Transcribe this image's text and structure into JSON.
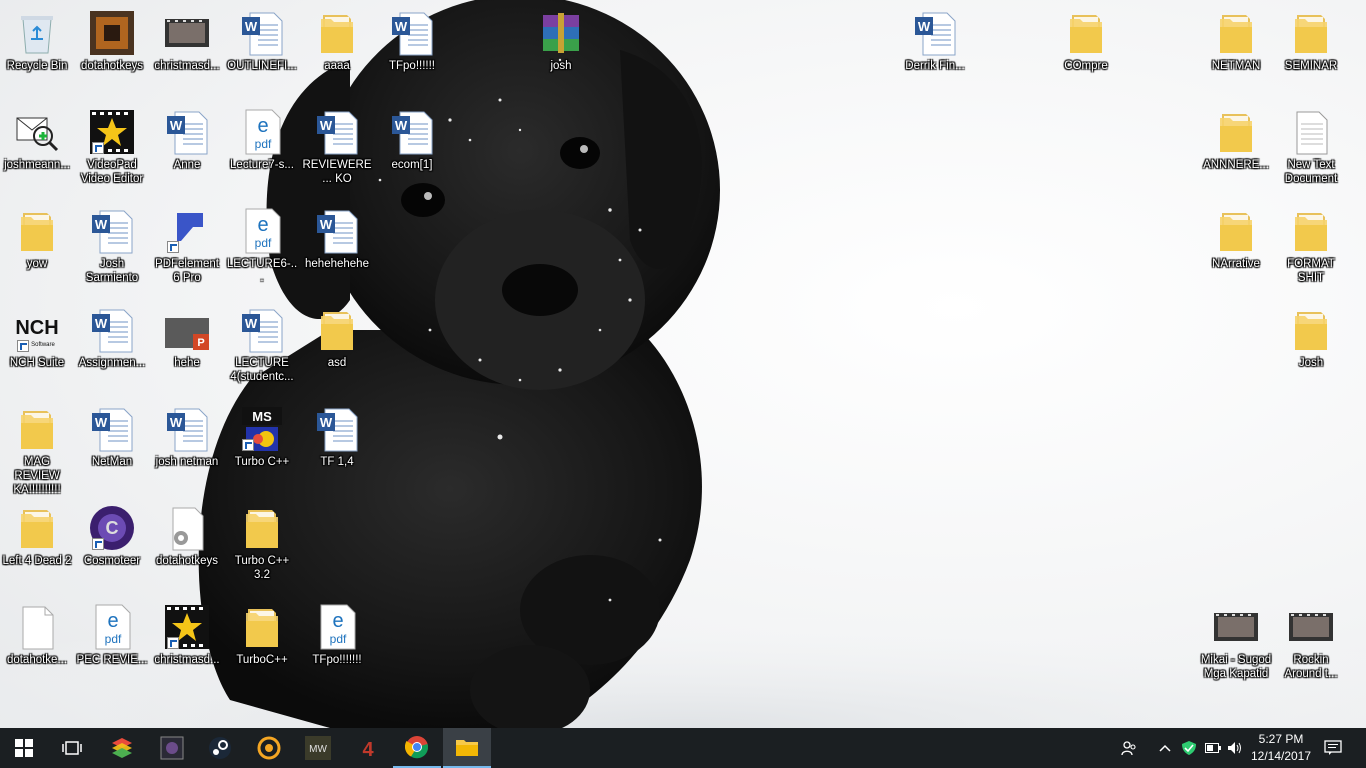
{
  "desktop": {
    "icons": [
      {
        "label": "Recycle Bin",
        "icon": "recycle-bin-icon"
      },
      {
        "label": "dotahotkeys",
        "icon": "app-icon"
      },
      {
        "label": "christmasd...",
        "icon": "video-thumbnail-icon"
      },
      {
        "label": "OUTLINEFI...",
        "icon": "word-document-icon"
      },
      {
        "label": "aaaa",
        "icon": "folder-icon"
      },
      {
        "label": "TFpo!!!!!!",
        "icon": "word-document-icon"
      },
      {
        "label": "josh",
        "icon": "winrar-archive-icon"
      },
      {
        "label": "joshmeann...",
        "icon": "mail-app-icon"
      },
      {
        "label": "VideoPad Video Editor",
        "icon": "videopad-icon"
      },
      {
        "label": "Anne",
        "icon": "word-document-icon"
      },
      {
        "label": "Lecture7-s...",
        "icon": "edge-pdf-icon"
      },
      {
        "label": "REVIEWERE... KO",
        "icon": "word-document-icon"
      },
      {
        "label": "ecom[1]",
        "icon": "word-document-icon"
      },
      {
        "label": "yow",
        "icon": "folder-icon"
      },
      {
        "label": "Josh Sarmiento",
        "icon": "word-document-icon"
      },
      {
        "label": "PDFelement 6 Pro",
        "icon": "pdfelement-icon"
      },
      {
        "label": "LECTURE6-...",
        "icon": "edge-pdf-icon"
      },
      {
        "label": "hehehehehe",
        "icon": "word-document-icon"
      },
      {
        "label": "NCH Suite",
        "icon": "nch-icon"
      },
      {
        "label": "Assignmen...",
        "icon": "word-document-icon"
      },
      {
        "label": "hehe",
        "icon": "powerpoint-icon"
      },
      {
        "label": "LECTURE 4(studentc...",
        "icon": "word-document-icon"
      },
      {
        "label": "asd",
        "icon": "folder-icon"
      },
      {
        "label": "MAG REVIEW KA!!!!!!!!!!",
        "icon": "folder-icon"
      },
      {
        "label": "NetMan",
        "icon": "word-document-icon"
      },
      {
        "label": "josh netman",
        "icon": "word-document-icon"
      },
      {
        "label": "Turbo C++",
        "icon": "turbo-cpp-icon"
      },
      {
        "label": "TF 1,4",
        "icon": "word-document-icon"
      },
      {
        "label": "Left 4 Dead 2",
        "icon": "folder-icon"
      },
      {
        "label": "Cosmoteer",
        "icon": "cosmoteer-icon"
      },
      {
        "label": "dotahotkeys",
        "icon": "settings-file-icon"
      },
      {
        "label": "Turbo C++ 3.2",
        "icon": "folder-icon"
      },
      {
        "label": "dotahotke...",
        "icon": "blank-file-icon"
      },
      {
        "label": "PEC REVIE...",
        "icon": "edge-pdf-icon"
      },
      {
        "label": "christmasd...",
        "icon": "videopad-icon"
      },
      {
        "label": "TurboC++",
        "icon": "folder-icon"
      },
      {
        "label": "TFpo!!!!!!!",
        "icon": "edge-pdf-icon"
      },
      {
        "label": "Derrik Fin...",
        "icon": "word-document-icon"
      },
      {
        "label": "COmpre",
        "icon": "folder-icon"
      },
      {
        "label": "NETMAN",
        "icon": "folder-icon"
      },
      {
        "label": "SEMINAR",
        "icon": "folder-icon"
      },
      {
        "label": "ANNNERE...",
        "icon": "folder-icon"
      },
      {
        "label": "New Text Document",
        "icon": "text-document-icon"
      },
      {
        "label": "NArrative",
        "icon": "folder-icon"
      },
      {
        "label": "FORMAT SHIT",
        "icon": "folder-icon"
      },
      {
        "label": "Josh",
        "icon": "folder-icon"
      },
      {
        "label": "Mikai - Sugod Mga Kapatid",
        "icon": "video-thumbnail-icon"
      },
      {
        "label": "Rockin Around t...",
        "icon": "video-thumbnail-icon"
      }
    ]
  },
  "taskbar": {
    "apps": [
      {
        "name": "start-button",
        "icon": "windows-icon"
      },
      {
        "name": "task-view-button",
        "icon": "task-view-icon"
      },
      {
        "name": "bluestacks",
        "icon": "bluestacks-icon"
      },
      {
        "name": "game-app",
        "icon": "dota-icon"
      },
      {
        "name": "steam",
        "icon": "steam-icon"
      },
      {
        "name": "garena",
        "icon": "garena-icon"
      },
      {
        "name": "mw-game",
        "icon": "mw-icon"
      },
      {
        "name": "game-4",
        "icon": "l4d-icon"
      },
      {
        "name": "chrome",
        "icon": "chrome-icon"
      },
      {
        "name": "file-explorer",
        "icon": "folder-icon"
      }
    ],
    "tray_icons": [
      "people-icon",
      "chevron-up-icon",
      "shield-icon",
      "battery-icon",
      "volume-icon"
    ],
    "clock": {
      "time": "5:27 PM",
      "date": "12/14/2017"
    },
    "action_center_icon": "notification-icon"
  }
}
